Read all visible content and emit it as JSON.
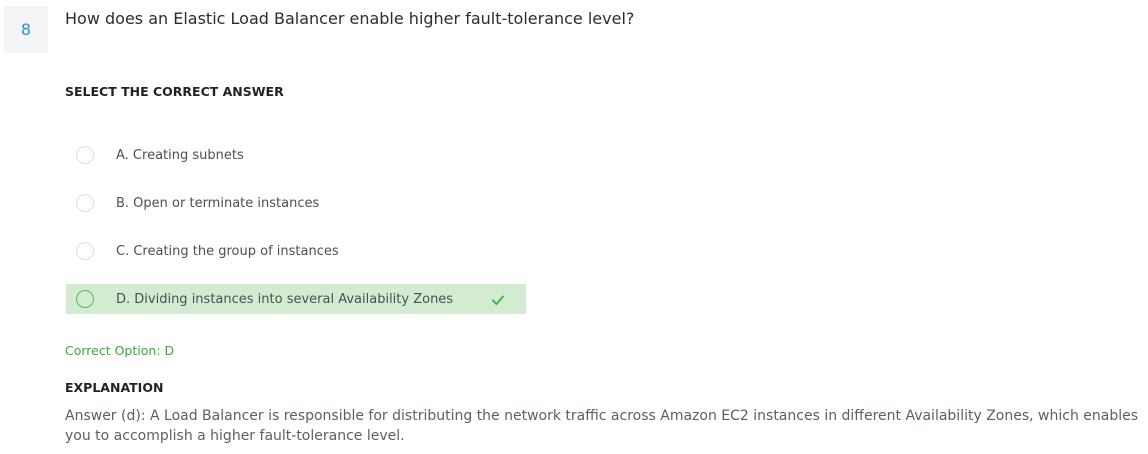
{
  "question": {
    "number": "8",
    "text": "How does an Elastic Load Balancer enable higher fault-tolerance level?"
  },
  "select_label": "SELECT THE CORRECT ANSWER",
  "options": [
    {
      "label": "A. Creating subnets",
      "correct": false
    },
    {
      "label": "B. Open or terminate instances",
      "correct": false
    },
    {
      "label": "C. Creating the group of instances",
      "correct": false
    },
    {
      "label": "D. Dividing instances into several Availability Zones",
      "correct": true
    }
  ],
  "correct_option": "Correct Option: D",
  "explanation": {
    "label": "EXPLANATION",
    "text": "Answer (d): A Load Balancer is responsible for distributing the network traffic across Amazon EC2 instances in different Availability Zones, which enables you to accomplish a higher fault-tolerance level."
  },
  "colors": {
    "accent": "#2e8fd8",
    "correct_bg": "#d3ecd1",
    "correct_text": "#3aa83a"
  },
  "icons": {
    "correct_mark": "check-icon"
  }
}
